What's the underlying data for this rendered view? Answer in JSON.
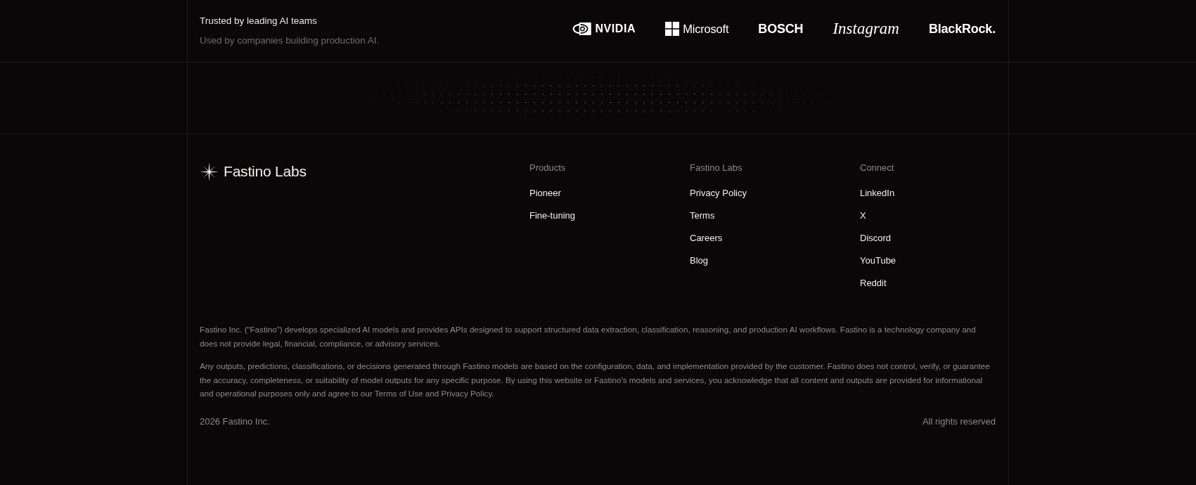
{
  "trust_bar": {
    "title": "Trusted by leading AI teams",
    "subtitle": "Used by companies building production AI.",
    "logos": [
      {
        "kind": "eye",
        "name": "NVIDIA"
      },
      {
        "kind": "squares",
        "name": "Microsoft"
      },
      {
        "kind": "bold",
        "name": "BOSCH"
      },
      {
        "kind": "script",
        "name": "Instagram"
      },
      {
        "kind": "bold",
        "name": "BlackRock."
      }
    ]
  },
  "footer": {
    "brand": "Fastino Labs",
    "columns": [
      {
        "heading": "Products",
        "links": [
          "Pioneer",
          "Fine-tuning"
        ]
      },
      {
        "heading": "Fastino Labs",
        "links": [
          "Privacy Policy",
          "Terms",
          "Careers",
          "Blog"
        ]
      },
      {
        "heading": "Connect",
        "links": [
          "LinkedIn",
          "X",
          "Discord",
          "YouTube",
          "Reddit"
        ]
      }
    ],
    "disclaimer": [
      "Fastino Inc. (“Fastino”) develops specialized AI models and provides APIs designed to support structured data extraction, classification, reasoning, and production AI workflows. Fastino is a technology company and does not provide legal, financial, compliance, or advisory services.",
      "Any outputs, predictions, classifications, or decisions generated through Fastino models are based on the configuration, data, and implementation provided by the customer. Fastino does not control, verify, or guarantee the accuracy, completeness, or suitability of model outputs for any specific purpose. By using this website or Fastino’s models and services, you acknowledge that all content and outputs are provided for informational and operational purposes only and agree to our Terms of Use and Privacy Policy."
    ],
    "copyright": "2026 Fastino Inc.",
    "rights": "All rights reserved"
  }
}
